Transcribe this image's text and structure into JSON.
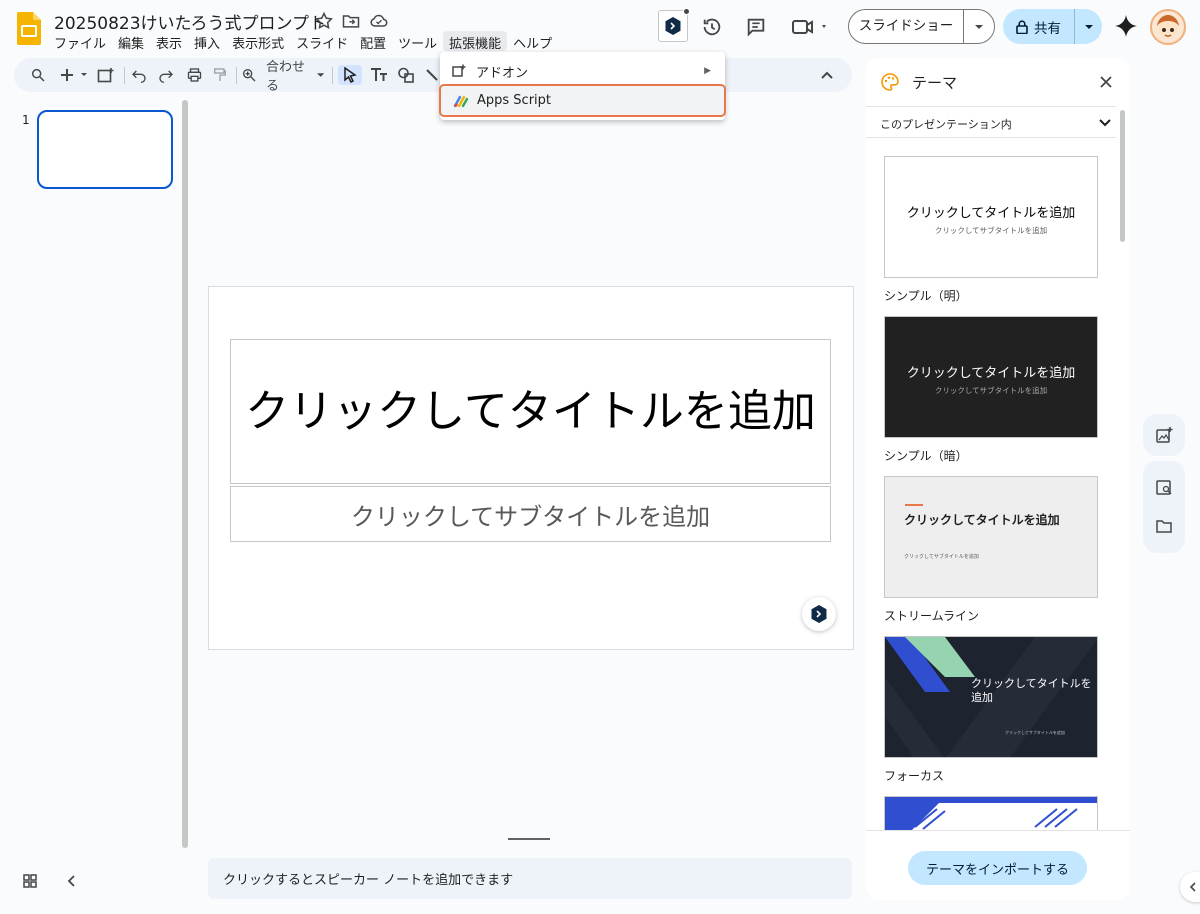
{
  "app": {
    "doc_title": "20250823けいたろう式プロンプト"
  },
  "menubar": {
    "items": [
      "ファイル",
      "編集",
      "表示",
      "挿入",
      "表示形式",
      "スライド",
      "配置",
      "ツール",
      "拡張機能",
      "ヘルプ"
    ],
    "active": "拡張機能"
  },
  "extensions_menu": {
    "addons_label": "アドオン",
    "appsscript_label": "Apps Script",
    "submenu_arrow": "▶"
  },
  "header": {
    "slideshow_label": "スライドショー",
    "share_label": "共有"
  },
  "toolbar": {
    "zoom_label": "合わせる"
  },
  "filmstrip": {
    "slide_number": "1"
  },
  "slide": {
    "title": "クリックしてタイトルを追加",
    "subtitle": "クリックしてサブタイトルを追加"
  },
  "notes": {
    "placeholder": "クリックするとスピーカー ノートを追加できます"
  },
  "theme_panel": {
    "title": "テーマ",
    "filter_label": "このプレゼンテーション内",
    "import_button": "テーマをインポートする",
    "themes": [
      {
        "name": "シンプル（明）",
        "title": "クリックしてタイトルを追加",
        "subtitle": "クリックしてサブタイトルを追加"
      },
      {
        "name": "シンプル（暗）",
        "title": "クリックしてタイトルを追加",
        "subtitle": "クリックしてサブタイトルを追加"
      },
      {
        "name": "ストリームライン",
        "title": "クリックしてタイトルを追加",
        "subtitle": "クリックしてサブタイトルを追加"
      },
      {
        "name": "フォーカス",
        "title_line1": "クリックしてタイトルを",
        "title_line2": "追加",
        "subtitle": "クリックしてサブタイトルを追加"
      }
    ]
  },
  "colors": {
    "accent_blue": "#0b57d0",
    "share_bg": "#c2e7ff",
    "highlight_border": "#e8774a",
    "logo_yellow": "#f4b400"
  }
}
